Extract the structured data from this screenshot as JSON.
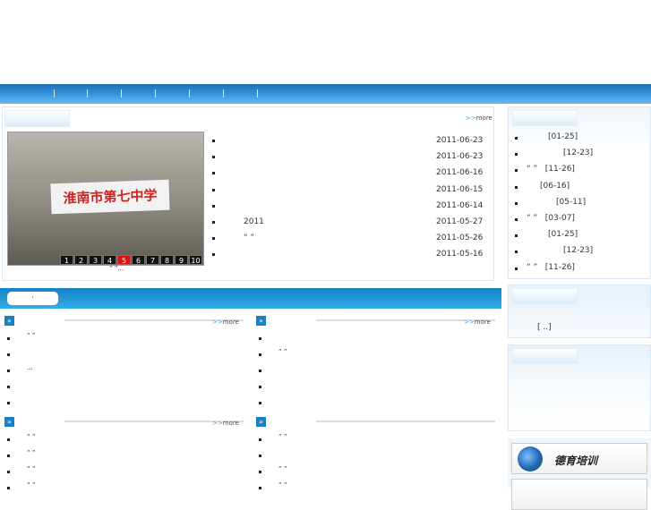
{
  "nav": {
    "items": [
      "",
      "",
      "",
      "",
      "",
      "",
      "",
      ""
    ]
  },
  "news": {
    "more": "more",
    "items": [
      {
        "title": "",
        "date": "2011-06-23"
      },
      {
        "title": "",
        "date": "2011-06-23"
      },
      {
        "title": "",
        "date": "2011-06-16"
      },
      {
        "title": "",
        "date": "2011-06-15"
      },
      {
        "title": "",
        "date": "2011-06-14"
      },
      {
        "title": "2011",
        "date": "2011-05-27"
      },
      {
        "title": "“ ”",
        "date": "2011-05-26"
      },
      {
        "title": "",
        "date": "2011-05-16"
      }
    ],
    "slider": {
      "banner": "淮南市第七中学",
      "pages": [
        "1",
        "2",
        "3",
        "4",
        "5",
        "6",
        "7",
        "8",
        "9",
        "10"
      ],
      "active": "5",
      "caption": "“ ”..."
    }
  },
  "bar": {
    "pill": "·"
  },
  "sections": [
    {
      "more": "more",
      "items": [
        "“ ”",
        "",
        "...",
        "",
        ""
      ]
    },
    {
      "more": "more",
      "items": [
        "",
        "“ ”",
        "",
        "",
        ""
      ]
    },
    {
      "more": "more",
      "items": [
        "“ ”",
        "“ ”",
        "“ ”",
        "“ ”"
      ]
    },
    {
      "more": "",
      "items": [
        "“ ”",
        "",
        "“ ”",
        "“ ”"
      ]
    }
  ],
  "sidebar": {
    "list": [
      "[01-25]",
      "[12-23]",
      "“ ”   [11-26]",
      "[06-16]",
      "[05-11]",
      "“ ”   [03-07]",
      "[01-25]",
      "[12-23]",
      "“ ”   [11-26]"
    ],
    "box2_text": "[ ..]",
    "buttons": [
      "德育培训",
      ""
    ]
  }
}
